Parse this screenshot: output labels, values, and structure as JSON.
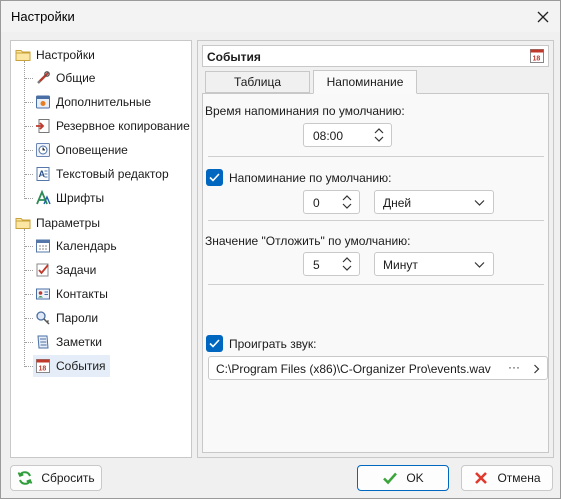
{
  "window": {
    "title": "Настройки"
  },
  "tree": {
    "root_label": "Настройки",
    "root_children": [
      {
        "label": "Общие",
        "icon": "tools-icon"
      },
      {
        "label": "Дополнительные",
        "icon": "advanced-icon"
      },
      {
        "label": "Резервное копирование",
        "icon": "backup-icon"
      },
      {
        "label": "Оповещение",
        "icon": "notification-icon"
      },
      {
        "label": "Текстовый редактор",
        "icon": "text-editor-icon"
      },
      {
        "label": "Шрифты",
        "icon": "fonts-icon"
      }
    ],
    "params_label": "Параметры",
    "params_children": [
      {
        "label": "Календарь",
        "icon": "calendar-icon"
      },
      {
        "label": "Задачи",
        "icon": "tasks-icon"
      },
      {
        "label": "Контакты",
        "icon": "contacts-icon"
      },
      {
        "label": "Пароли",
        "icon": "passwords-icon"
      },
      {
        "label": "Заметки",
        "icon": "notes-icon"
      },
      {
        "label": "События",
        "icon": "events-icon"
      }
    ],
    "selected": "События"
  },
  "panel": {
    "title": "События",
    "tabs": [
      "Таблица",
      "Напоминание"
    ],
    "active_tab": "Напоминание",
    "default_time_label": "Время напоминания по умолчанию:",
    "default_time_value": "08:00",
    "default_reminder_label": "Напоминание по умолчанию:",
    "default_reminder_checked": true,
    "default_reminder_value": "0",
    "default_reminder_unit": "Дней",
    "snooze_label": "Значение \"Отложить\" по умолчанию:",
    "snooze_value": "5",
    "snooze_unit": "Минут",
    "play_sound_label": "Проиграть звук:",
    "play_sound_checked": true,
    "sound_path": "C:\\Program Files (x86)\\C-Organizer Pro\\events.wav",
    "sound_browse": "···"
  },
  "buttons": {
    "reset": "Сбросить",
    "ok": "OK",
    "cancel": "Отмена"
  },
  "colors": {
    "accent": "#0067c0",
    "selected_bg": "#e5eef8"
  }
}
